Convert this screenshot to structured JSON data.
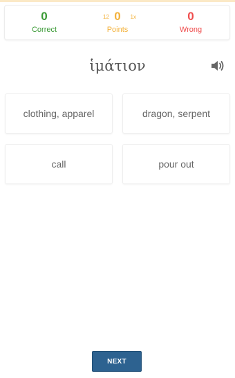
{
  "score": {
    "correct": {
      "value": "0",
      "label": "Correct"
    },
    "points": {
      "value": "0",
      "label": "Points",
      "multiplier_left": "12",
      "multiplier_right": "1x"
    },
    "wrong": {
      "value": "0",
      "label": "Wrong"
    }
  },
  "prompt": {
    "word": "ἱμάτιον",
    "audio_icon": "speaker-icon"
  },
  "options": [
    {
      "label": "clothing, apparel"
    },
    {
      "label": "dragon, serpent"
    },
    {
      "label": "call"
    },
    {
      "label": "pour out"
    }
  ],
  "next_button": {
    "label": "NEXT"
  },
  "colors": {
    "correct": "#3a9a35",
    "points": "#f3b23c",
    "wrong": "#ef4d4d",
    "button": "#2d6290"
  }
}
